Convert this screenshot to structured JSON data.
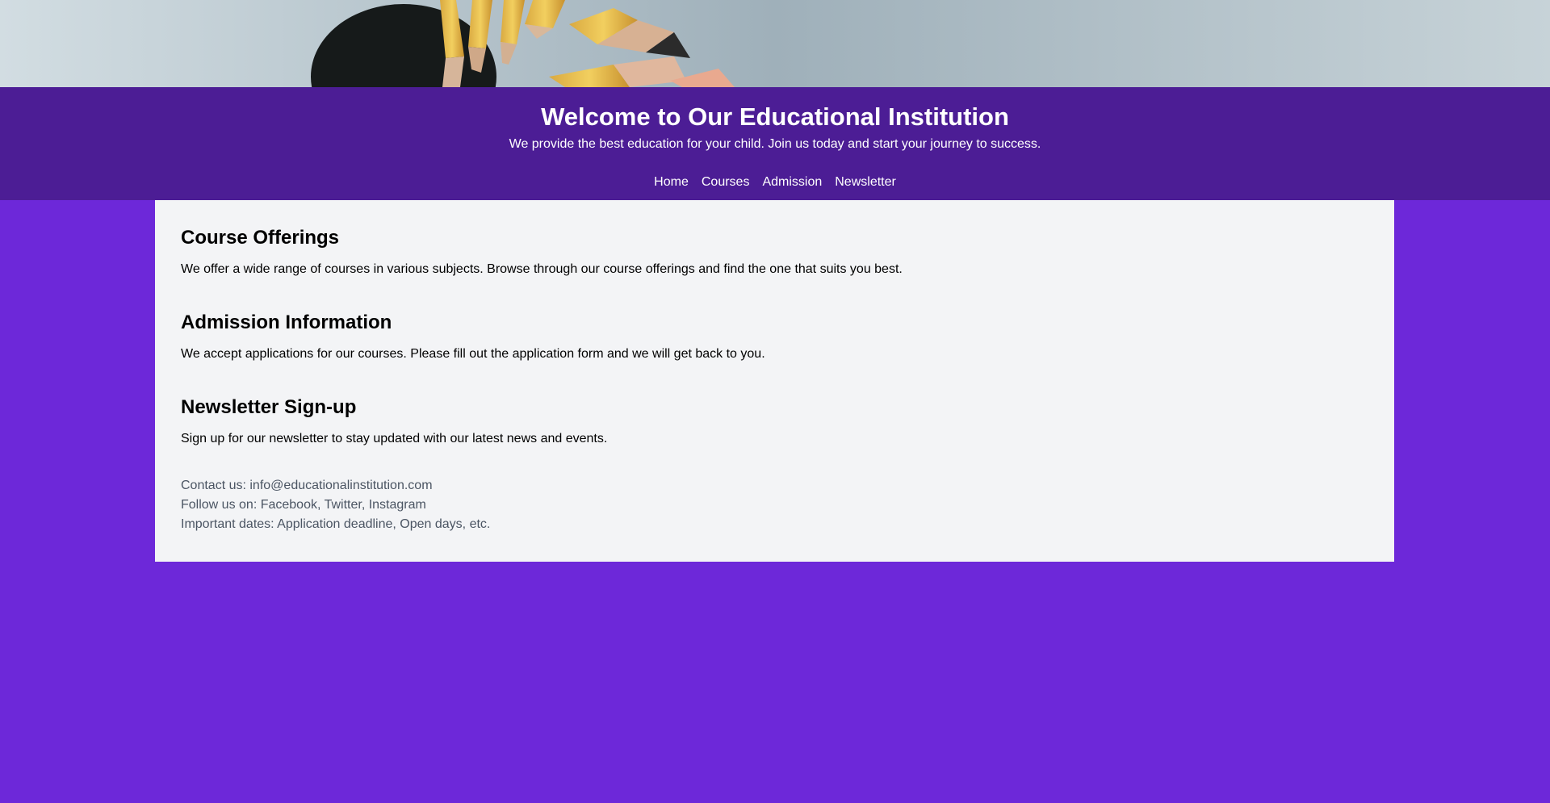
{
  "header": {
    "title": "Welcome to Our Educational Institution",
    "subtitle": "We provide the best education for your child. Join us today and start your journey to success."
  },
  "nav": [
    {
      "label": "Home"
    },
    {
      "label": "Courses"
    },
    {
      "label": "Admission"
    },
    {
      "label": "Newsletter"
    }
  ],
  "sections": [
    {
      "heading": "Course Offerings",
      "text": "We offer a wide range of courses in various subjects. Browse through our course offerings and find the one that suits you best."
    },
    {
      "heading": "Admission Information",
      "text": "We accept applications for our courses. Please fill out the application form and we will get back to you."
    },
    {
      "heading": "Newsletter Sign-up",
      "text": "Sign up for our newsletter to stay updated with our latest news and events."
    }
  ],
  "footer": {
    "contact": "Contact us: info@educationalinstitution.com",
    "social": "Follow us on: Facebook, Twitter, Instagram",
    "dates": "Important dates: Application deadline, Open days, etc."
  },
  "colors": {
    "page_background": "#6d28d9",
    "header_background": "#4c1d95",
    "content_background": "#f3f4f6",
    "footer_text": "#4b5563"
  },
  "icons": {
    "hero_image": "pencils-in-cup-photo"
  }
}
